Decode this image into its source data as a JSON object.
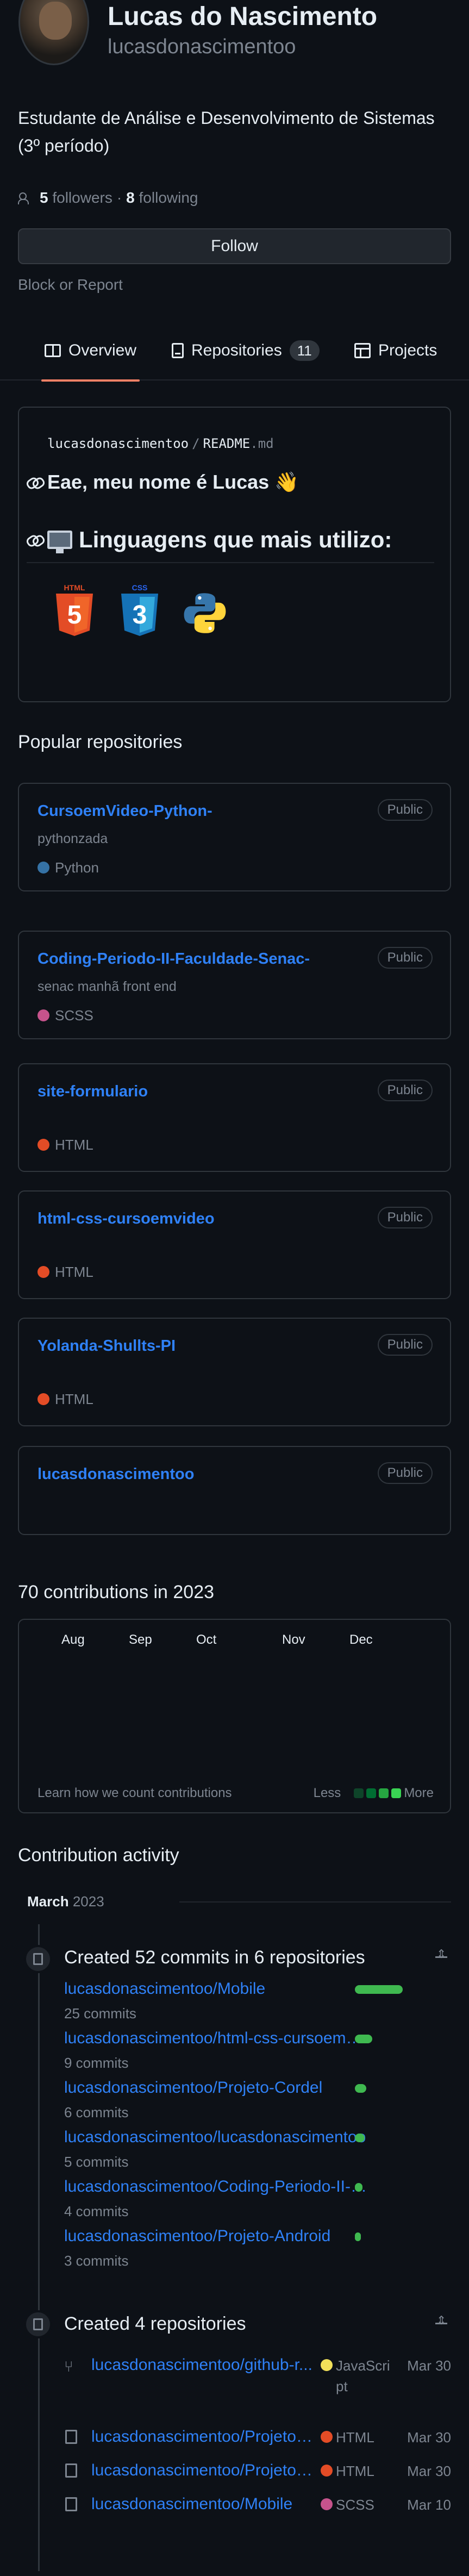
{
  "profile": {
    "name": "Lucas do Nascimento",
    "login": "lucasdonascimentoo",
    "bio": "Estudante de Análise e Desenvolvimento de Sistemas (3º período)",
    "followers_count": "5",
    "followers_label": "followers",
    "separator": "·",
    "following_count": "8",
    "following_label": "following",
    "follow_button": "Follow",
    "block_report": "Block or Report"
  },
  "tabs": [
    {
      "label": "Overview"
    },
    {
      "label": "Repositories",
      "count": "11"
    },
    {
      "label": "Projects"
    }
  ],
  "readme": {
    "owner": "lucasdonascimentoo",
    "sep": "/",
    "file": "README",
    "ext": ".md",
    "heading1": "Eae, meu nome é Lucas 👋",
    "heading2": "Linguagens que mais utilizo:",
    "logo_labels": [
      "HTML",
      "CSS"
    ]
  },
  "popular": {
    "title": "Popular repositories",
    "repos": [
      {
        "name": "CursoemVideo-Python-",
        "desc": "pythonzada",
        "visibility": "Public",
        "language": "Python",
        "color": "#3572A5"
      },
      {
        "name": "Coding-Periodo-II-Faculdade-Senac-",
        "desc": "senac manhã front end",
        "visibility": "Public",
        "language": "SCSS",
        "color": "#c6538c"
      },
      {
        "name": "site-formulario",
        "desc": "",
        "visibility": "Public",
        "language": "HTML",
        "color": "#e34c26"
      },
      {
        "name": "html-css-cursoemvideo",
        "desc": "",
        "visibility": "Public",
        "language": "HTML",
        "color": "#e34c26"
      },
      {
        "name": "Yolanda-Shullts-PI",
        "desc": "",
        "visibility": "Public",
        "language": "HTML",
        "color": "#e34c26"
      },
      {
        "name": "lucasdonascimentoo",
        "desc": "",
        "visibility": "Public",
        "language": "",
        "color": ""
      }
    ]
  },
  "contributions": {
    "title": "70 contributions in 2023",
    "months": [
      "Aug",
      "Sep",
      "Oct",
      "Nov",
      "Dec"
    ],
    "learn": "Learn how we count contributions",
    "less": "Less",
    "more": "More",
    "legend_colors": [
      "#161b22",
      "#0e4429",
      "#006d32",
      "#26a641",
      "#39d353"
    ]
  },
  "activity": {
    "title": "Contribution activity",
    "month": "March",
    "year": "2023",
    "commits_title": "Created 52 commits in 6 repositories",
    "commits": [
      {
        "repo": "lucasdonascimentoo/Mobile",
        "count": "25 commits",
        "share": 25
      },
      {
        "repo": "lucasdonascimentoo/html-css-cursoemvideo",
        "count": "9 commits",
        "share": 9
      },
      {
        "repo": "lucasdonascimentoo/Projeto-Cordel",
        "count": "6 commits",
        "share": 6
      },
      {
        "repo": "lucasdonascimentoo/lucasdonascimentoo",
        "count": "5 commits",
        "share": 5
      },
      {
        "repo": "lucasdonascimentoo/Coding-Periodo-II-Faculdade-Senac-",
        "count": "4 commits",
        "share": 4
      },
      {
        "repo": "lucasdonascimentoo/Projeto-Android",
        "count": "3 commits",
        "share": 3
      }
    ],
    "repos_title": "Created 4 repositories",
    "new_repos": [
      {
        "repo": "lucasdonascimentoo/github-r...",
        "language": "JavaScript",
        "color": "#f1e05a",
        "date": "Mar 30",
        "fork": true
      },
      {
        "repo": "lucasdonascimentoo/Projeto-Cordel",
        "language": "HTML",
        "color": "#e34c26",
        "date": "Mar 30",
        "fork": false
      },
      {
        "repo": "lucasdonascimentoo/Projeto-Android",
        "language": "HTML",
        "color": "#e34c26",
        "date": "Mar 30",
        "fork": false
      },
      {
        "repo": "lucasdonascimentoo/Mobile",
        "language": "SCSS",
        "color": "#c6538c",
        "date": "Mar 10",
        "fork": false
      }
    ]
  }
}
